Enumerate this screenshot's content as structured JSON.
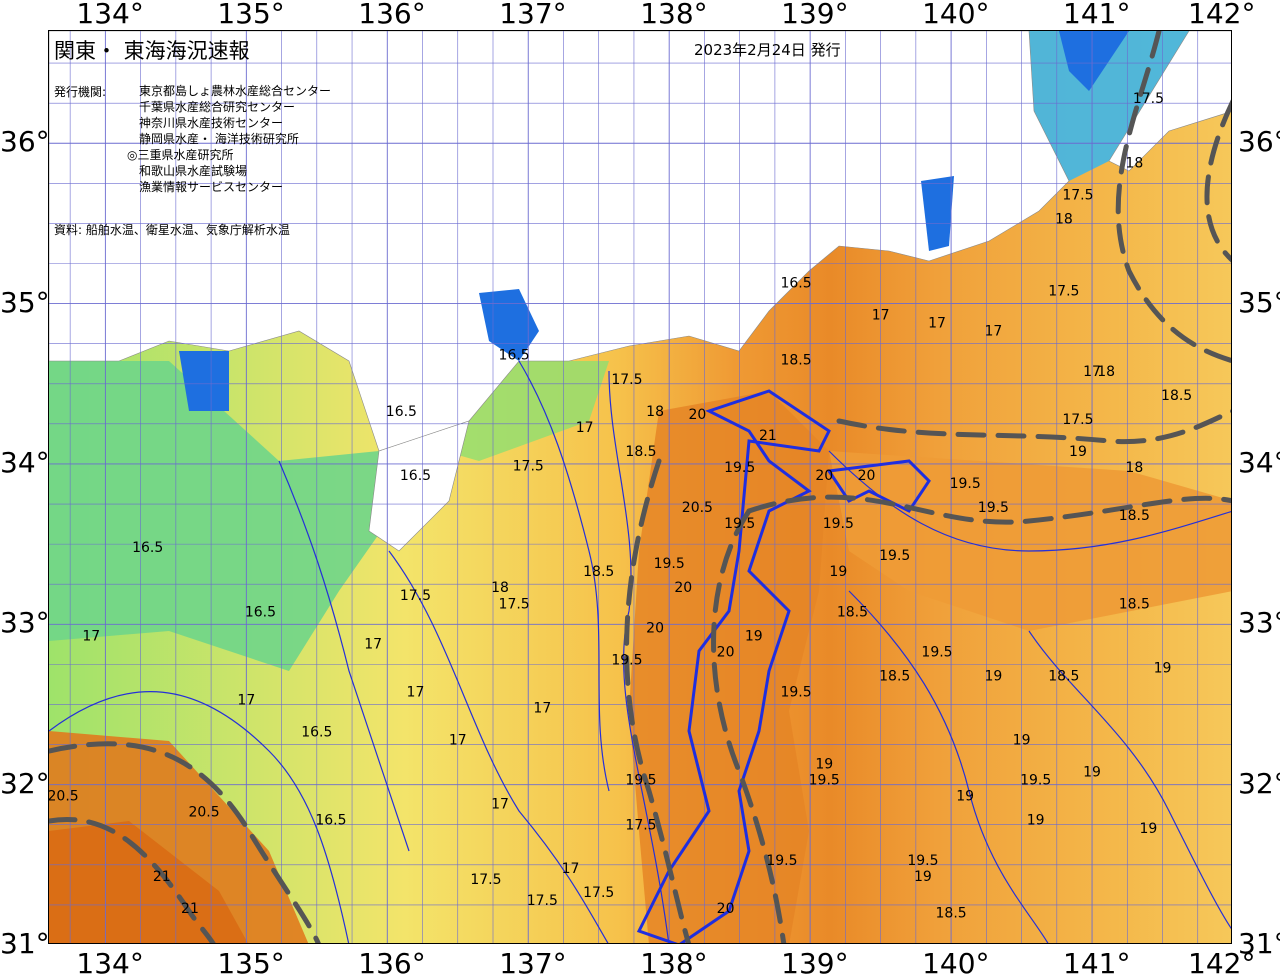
{
  "header": {
    "title": "関東・ 東海海況速報",
    "date": "2023年2月24日 発行",
    "publisher_label": "発行機関:",
    "publishers": [
      "東京都島しょ農林水産総合センター",
      "千葉県水産総合研究センター",
      "神奈川県水産技術センター",
      "静岡県水産・ 海洋技術研究所",
      "◎三重県水産研究所",
      "和歌山県水産試験場",
      "漁業情報サービスセンター"
    ],
    "source": "資料: 船舶水温、衛星水温、気象庁解析水温"
  },
  "axes": {
    "lon_labels": [
      "134°",
      "135°",
      "136°",
      "137°",
      "138°",
      "139°",
      "140°",
      "141°",
      "142°"
    ],
    "lat_labels": [
      "36°",
      "35°",
      "34°",
      "33°",
      "32°",
      "31°"
    ],
    "lon_range": [
      133.6,
      142.0
    ],
    "lat_range": [
      31.0,
      36.7
    ]
  },
  "legend_colors": {
    "very_cold": "#1e6fe0",
    "cold": "#3fb6e8",
    "cool": "#58d38a",
    "mild": "#b3e86a",
    "temperate": "#f3e46a",
    "warm": "#f6c24b",
    "hot": "#ef9a34",
    "very_hot": "#e07a1e",
    "land": "#ffffff",
    "contour_thick": "#1f2ee0",
    "kuroshio_axis": "#555555"
  },
  "contour_labels": [
    {
      "text": "16.5",
      "lon": 134.3,
      "lat": 33.45
    },
    {
      "text": "16.5",
      "lon": 135.1,
      "lat": 33.05
    },
    {
      "text": "16.5",
      "lon": 136.2,
      "lat": 33.9
    },
    {
      "text": "16.5",
      "lon": 136.1,
      "lat": 34.3
    },
    {
      "text": "16.5",
      "lon": 135.5,
      "lat": 32.3
    },
    {
      "text": "16.5",
      "lon": 135.6,
      "lat": 31.75
    },
    {
      "text": "16.5",
      "lon": 136.9,
      "lat": 34.65
    },
    {
      "text": "16.5",
      "lon": 138.9,
      "lat": 35.1
    },
    {
      "text": "17",
      "lon": 133.9,
      "lat": 32.9
    },
    {
      "text": "17",
      "lon": 135.0,
      "lat": 32.5
    },
    {
      "text": "17",
      "lon": 135.9,
      "lat": 32.85
    },
    {
      "text": "17",
      "lon": 136.2,
      "lat": 32.55
    },
    {
      "text": "17",
      "lon": 136.5,
      "lat": 32.25
    },
    {
      "text": "17",
      "lon": 137.1,
      "lat": 32.45
    },
    {
      "text": "17",
      "lon": 136.8,
      "lat": 31.85
    },
    {
      "text": "17",
      "lon": 137.4,
      "lat": 34.2
    },
    {
      "text": "17",
      "lon": 139.5,
      "lat": 34.9
    },
    {
      "text": "17",
      "lon": 139.9,
      "lat": 34.85
    },
    {
      "text": "17",
      "lon": 140.3,
      "lat": 34.8
    },
    {
      "text": "17",
      "lon": 141.0,
      "lat": 34.55
    },
    {
      "text": "17",
      "lon": 137.3,
      "lat": 31.45
    },
    {
      "text": "17.5",
      "lon": 137.7,
      "lat": 34.5
    },
    {
      "text": "17.5",
      "lon": 137.0,
      "lat": 33.96
    },
    {
      "text": "17.5",
      "lon": 136.2,
      "lat": 33.15
    },
    {
      "text": "17.5",
      "lon": 136.9,
      "lat": 33.1
    },
    {
      "text": "17.5",
      "lon": 137.1,
      "lat": 31.25
    },
    {
      "text": "17.5",
      "lon": 136.7,
      "lat": 31.38
    },
    {
      "text": "17.5",
      "lon": 137.5,
      "lat": 31.3
    },
    {
      "text": "17.5",
      "lon": 137.8,
      "lat": 31.72
    },
    {
      "text": "17.5",
      "lon": 140.9,
      "lat": 34.25
    },
    {
      "text": "17.5",
      "lon": 140.8,
      "lat": 35.05
    },
    {
      "text": "17.5",
      "lon": 140.9,
      "lat": 35.65
    },
    {
      "text": "17.5",
      "lon": 141.4,
      "lat": 36.25
    },
    {
      "text": "18",
      "lon": 137.9,
      "lat": 34.3
    },
    {
      "text": "18",
      "lon": 136.8,
      "lat": 33.2
    },
    {
      "text": "18",
      "lon": 141.1,
      "lat": 34.55
    },
    {
      "text": "18",
      "lon": 141.3,
      "lat": 33.95
    },
    {
      "text": "18",
      "lon": 141.3,
      "lat": 35.85
    },
    {
      "text": "18",
      "lon": 140.8,
      "lat": 35.5
    },
    {
      "text": "18.5",
      "lon": 137.8,
      "lat": 34.05
    },
    {
      "text": "18.5",
      "lon": 138.9,
      "lat": 34.62
    },
    {
      "text": "18.5",
      "lon": 137.5,
      "lat": 33.3
    },
    {
      "text": "18.5",
      "lon": 139.3,
      "lat": 33.05
    },
    {
      "text": "18.5",
      "lon": 139.6,
      "lat": 32.65
    },
    {
      "text": "18.5",
      "lon": 140.8,
      "lat": 32.65
    },
    {
      "text": "18.5",
      "lon": 141.3,
      "lat": 33.1
    },
    {
      "text": "18.5",
      "lon": 141.3,
      "lat": 33.65
    },
    {
      "text": "18.5",
      "lon": 141.6,
      "lat": 34.4
    },
    {
      "text": "18.5",
      "lon": 140.0,
      "lat": 31.17
    },
    {
      "text": "19",
      "lon": 139.2,
      "lat": 33.3
    },
    {
      "text": "19",
      "lon": 138.6,
      "lat": 32.9
    },
    {
      "text": "19",
      "lon": 140.3,
      "lat": 32.65
    },
    {
      "text": "19",
      "lon": 140.5,
      "lat": 32.25
    },
    {
      "text": "19",
      "lon": 139.1,
      "lat": 32.1
    },
    {
      "text": "19",
      "lon": 140.1,
      "lat": 31.9
    },
    {
      "text": "19",
      "lon": 140.6,
      "lat": 31.75
    },
    {
      "text": "19",
      "lon": 141.0,
      "lat": 32.05
    },
    {
      "text": "19",
      "lon": 141.5,
      "lat": 32.7
    },
    {
      "text": "19",
      "lon": 141.4,
      "lat": 31.7
    },
    {
      "text": "19",
      "lon": 140.9,
      "lat": 34.05
    },
    {
      "text": "19",
      "lon": 139.8,
      "lat": 31.4
    },
    {
      "text": "19.5",
      "lon": 138.5,
      "lat": 33.6
    },
    {
      "text": "19.5",
      "lon": 139.2,
      "lat": 33.6
    },
    {
      "text": "19.5",
      "lon": 139.6,
      "lat": 33.4
    },
    {
      "text": "19.5",
      "lon": 140.3,
      "lat": 33.7
    },
    {
      "text": "19.5",
      "lon": 140.1,
      "lat": 33.85
    },
    {
      "text": "19.5",
      "lon": 138.0,
      "lat": 33.35
    },
    {
      "text": "19.5",
      "lon": 137.7,
      "lat": 32.75
    },
    {
      "text": "19.5",
      "lon": 138.9,
      "lat": 32.55
    },
    {
      "text": "19.5",
      "lon": 139.1,
      "lat": 32.0
    },
    {
      "text": "19.5",
      "lon": 140.6,
      "lat": 32.0
    },
    {
      "text": "19.5",
      "lon": 139.9,
      "lat": 32.8
    },
    {
      "text": "19.5",
      "lon": 138.8,
      "lat": 31.5
    },
    {
      "text": "19.5",
      "lon": 139.8,
      "lat": 31.5
    },
    {
      "text": "19.5",
      "lon": 138.5,
      "lat": 33.95
    },
    {
      "text": "19.5",
      "lon": 137.8,
      "lat": 32.0
    },
    {
      "text": "20",
      "lon": 138.2,
      "lat": 34.28
    },
    {
      "text": "20",
      "lon": 139.1,
      "lat": 33.9
    },
    {
      "text": "20",
      "lon": 139.4,
      "lat": 33.9
    },
    {
      "text": "20",
      "lon": 138.4,
      "lat": 32.8
    },
    {
      "text": "20",
      "lon": 137.9,
      "lat": 32.95
    },
    {
      "text": "20",
      "lon": 138.1,
      "lat": 33.2
    },
    {
      "text": "20",
      "lon": 138.4,
      "lat": 31.2
    },
    {
      "text": "20.5",
      "lon": 138.2,
      "lat": 33.7
    },
    {
      "text": "20.5",
      "lon": 134.7,
      "lat": 31.8
    },
    {
      "text": "20.5",
      "lon": 133.7,
      "lat": 31.9
    },
    {
      "text": "21",
      "lon": 134.4,
      "lat": 31.4
    },
    {
      "text": "21",
      "lon": 134.6,
      "lat": 31.2
    },
    {
      "text": "21",
      "lon": 138.7,
      "lat": 34.15
    }
  ]
}
